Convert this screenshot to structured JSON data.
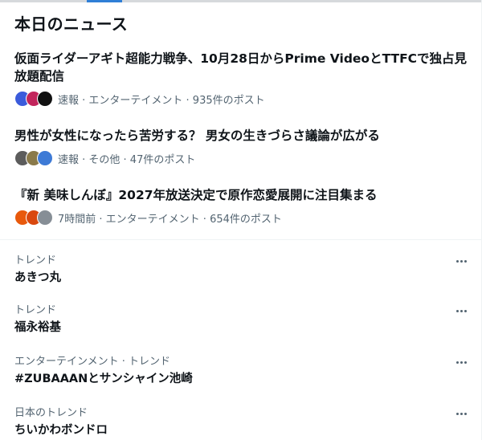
{
  "section_title": "本日のニュース",
  "news": [
    {
      "headline": "仮面ライダーアギト超能力戦争、10月28日からPrime VideoとTTFCで独占見放題配信",
      "meta": "速報 · エンターテイメント · 935件のポスト",
      "avatars": [
        "#3b5bdb",
        "#c2255c",
        "#111111"
      ]
    },
    {
      "headline": "男性が女性になったら苦労する？ 男女の生きづらさ議論が広がる",
      "meta": "速報 · その他 · 47件のポスト",
      "avatars": [
        "#5c5c5c",
        "#8a7a4a",
        "#3d7ad6"
      ]
    },
    {
      "headline": "『新 美味しんぼ』2027年放送決定で原作恋愛展開に注目集まる",
      "meta": "7時間前 · エンターテイメント · 654件のポスト",
      "avatars": [
        "#e8590c",
        "#d9480f",
        "#868e96"
      ]
    }
  ],
  "trends": [
    {
      "context": "トレンド",
      "name": "あきつ丸"
    },
    {
      "context": "トレンド",
      "name": "福永裕基"
    },
    {
      "context": "エンターテインメント · トレンド",
      "name": "#ZUBAAANとサンシャイン池崎"
    },
    {
      "context": "日本のトレンド",
      "name": "ちいかわボンドロ"
    }
  ],
  "colors": {
    "accent": "#2f7fd6",
    "muted_text": "#536471",
    "main_text": "#0f1419"
  },
  "icons": {
    "more": "more-horizontal-icon"
  }
}
